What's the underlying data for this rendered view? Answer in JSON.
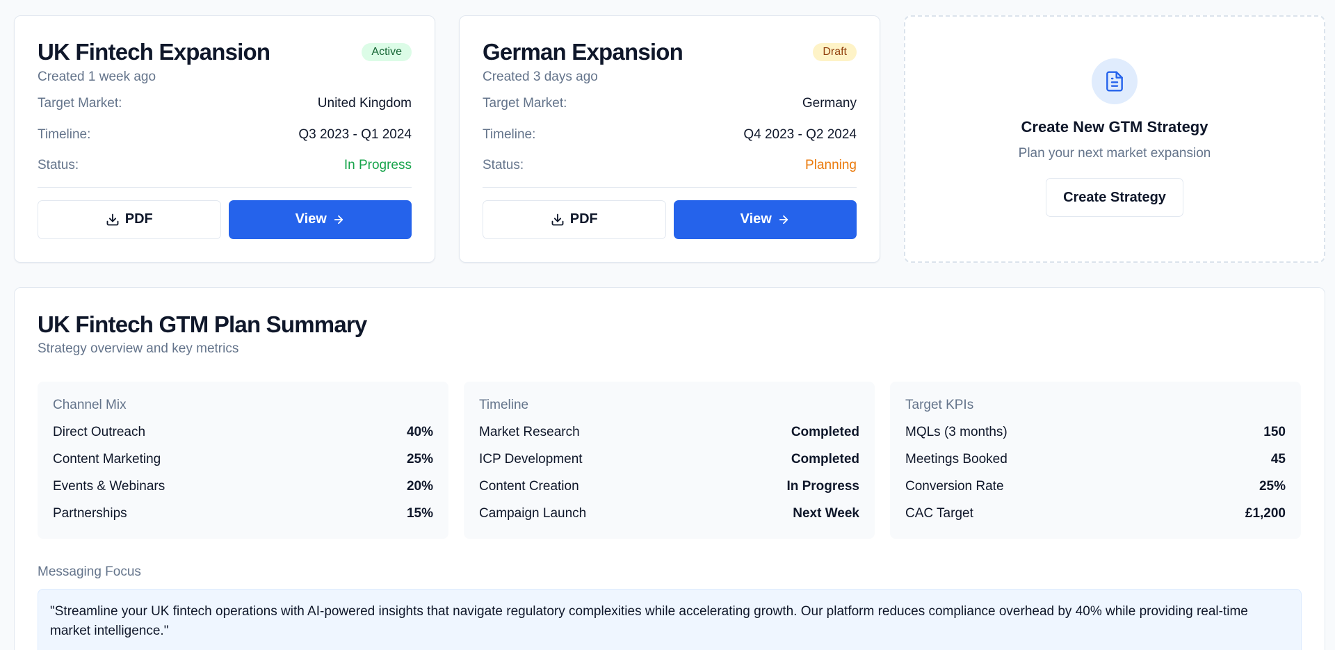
{
  "strategies": [
    {
      "title": "UK Fintech Expansion",
      "badge": "Active",
      "created": "Created 1 week ago",
      "target_market_label": "Target Market:",
      "target_market": "United Kingdom",
      "timeline_label": "Timeline:",
      "timeline": "Q3 2023 - Q1 2024",
      "status_label": "Status:",
      "status": "In Progress",
      "status_color": "#16a34a",
      "pdf_label": "PDF",
      "view_label": "View"
    },
    {
      "title": "German Expansion",
      "badge": "Draft",
      "created": "Created 3 days ago",
      "target_market_label": "Target Market:",
      "target_market": "Germany",
      "timeline_label": "Timeline:",
      "timeline": "Q4 2023 - Q2 2024",
      "status_label": "Status:",
      "status": "Planning",
      "status_color": "#ea7a0c",
      "pdf_label": "PDF",
      "view_label": "View"
    }
  ],
  "new_strategy": {
    "icon": "document-icon",
    "title": "Create New GTM Strategy",
    "subtitle": "Plan your next market expansion",
    "button_label": "Create Strategy"
  },
  "summary": {
    "title": "UK Fintech GTM Plan Summary",
    "subtitle": "Strategy overview and key metrics",
    "channel_mix": {
      "heading": "Channel Mix",
      "rows": [
        {
          "label": "Direct Outreach",
          "value": "40%"
        },
        {
          "label": "Content Marketing",
          "value": "25%"
        },
        {
          "label": "Events & Webinars",
          "value": "20%"
        },
        {
          "label": "Partnerships",
          "value": "15%"
        }
      ]
    },
    "timeline": {
      "heading": "Timeline",
      "rows": [
        {
          "label": "Market Research",
          "value": "Completed"
        },
        {
          "label": "ICP Development",
          "value": "Completed"
        },
        {
          "label": "Content Creation",
          "value": "In Progress"
        },
        {
          "label": "Campaign Launch",
          "value": "Next Week"
        }
      ]
    },
    "kpis": {
      "heading": "Target KPIs",
      "rows": [
        {
          "label": "MQLs (3 months)",
          "value": "150"
        },
        {
          "label": "Meetings Booked",
          "value": "45"
        },
        {
          "label": "Conversion Rate",
          "value": "25%"
        },
        {
          "label": "CAC Target",
          "value": "£1,200"
        }
      ]
    },
    "messaging_label": "Messaging Focus",
    "messaging_text": "\"Streamline your UK fintech operations with AI-powered insights that navigate regulatory complexities while accelerating growth. Our platform reduces compliance overhead by 40% while providing real-time market intelligence.\""
  },
  "colors": {
    "primary": "#2563eb",
    "active_badge_bg": "#dcfce7",
    "draft_badge_bg": "#fef3c7"
  }
}
